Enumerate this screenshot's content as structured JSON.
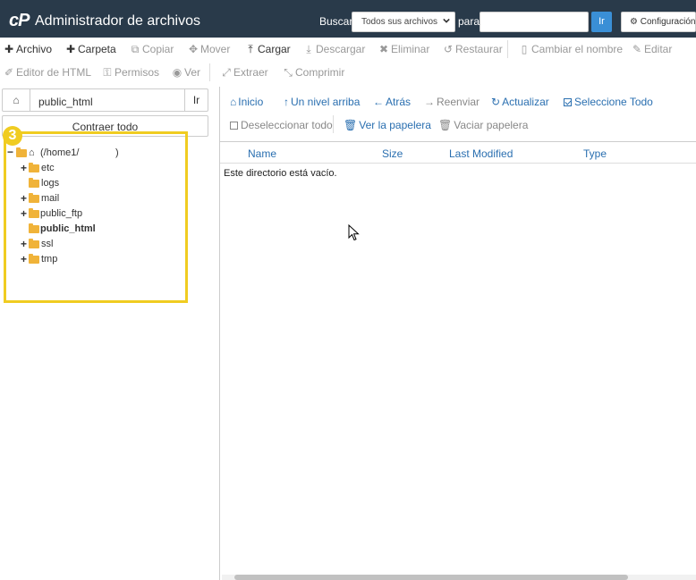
{
  "header": {
    "logo": "cP",
    "title": "Administrador de archivos",
    "search_label": "Buscar",
    "search_scope": "Todos sus archivos",
    "search_for_label": "para",
    "search_input_value": "",
    "search_go": "Ir",
    "settings_label": "Configuración"
  },
  "toolbar": {
    "file": "Archivo",
    "folder": "Carpeta",
    "copy": "Copiar",
    "move": "Mover",
    "upload": "Cargar",
    "download": "Descargar",
    "delete": "Eliminar",
    "restore": "Restaurar",
    "rename": "Cambiar el nombre",
    "edit": "Editar",
    "html_editor": "Editor de HTML",
    "permissions": "Permisos",
    "view": "Ver",
    "extract": "Extraer",
    "compress": "Comprimir"
  },
  "sidebar": {
    "path_value": "public_html",
    "path_go": "Ir",
    "collapse_all": "Contraer todo",
    "step_badge": "3",
    "root_label": "(/home1/",
    "root_close": ")",
    "items": [
      {
        "label": "etc",
        "expandable": "+"
      },
      {
        "label": "logs",
        "expandable": ""
      },
      {
        "label": "mail",
        "expandable": "+"
      },
      {
        "label": "public_ftp",
        "expandable": "+"
      },
      {
        "label": "public_html",
        "expandable": ""
      },
      {
        "label": "ssl",
        "expandable": "+"
      },
      {
        "label": "tmp",
        "expandable": "+"
      }
    ]
  },
  "nav": {
    "home": "Inicio",
    "up_one_level": "Un nivel arriba",
    "back": "Atrás",
    "forward": "Reenviar",
    "reload": "Actualizar",
    "select_all": "Seleccione Todo",
    "unselect_all": "Deseleccionar todo",
    "view_trash": "Ver la papelera",
    "empty_trash": "Vaciar papelera"
  },
  "table": {
    "columns": [
      "Name",
      "Size",
      "Last Modified",
      "Type"
    ],
    "empty_message": "Este directorio está vacío."
  },
  "colors": {
    "topbar": "#293a4a",
    "accent": "#2a6fb0",
    "highlight": "#f0cc21",
    "folder": "#f0b339"
  }
}
